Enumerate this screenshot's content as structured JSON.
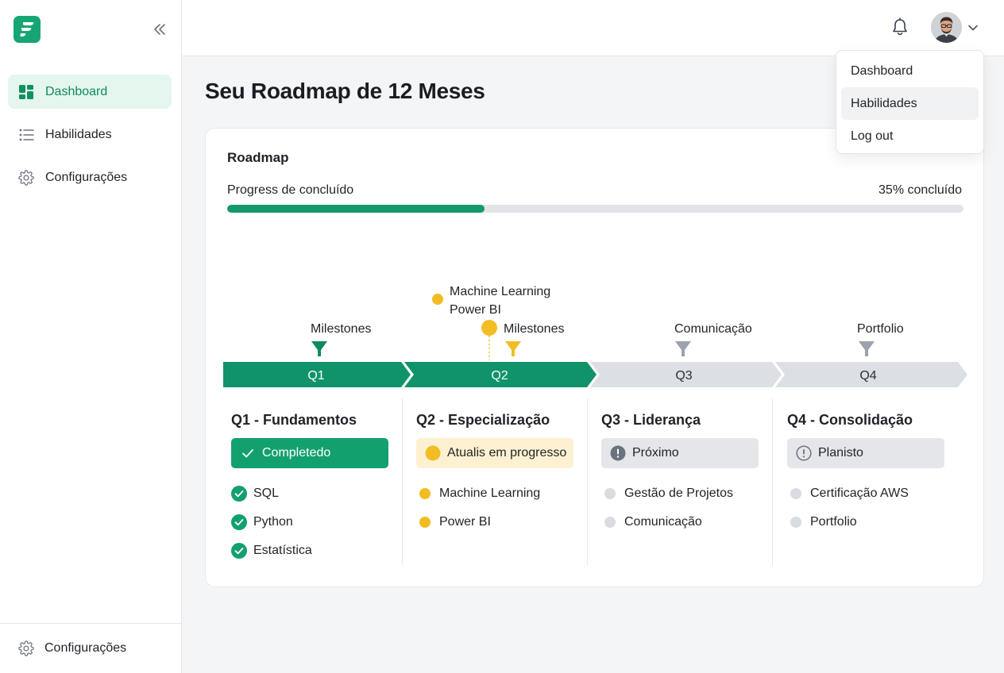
{
  "sidebar": {
    "items": [
      {
        "label": "Dashboard",
        "icon": "dashboard-icon",
        "active": true
      },
      {
        "label": "Habilidades",
        "icon": "list-icon",
        "active": false
      },
      {
        "label": "Configurações",
        "icon": "gear-icon",
        "active": false
      }
    ],
    "bottom_label": "Configurações"
  },
  "user_menu": {
    "items": [
      "Dashboard",
      "Habilidades",
      "Log out"
    ]
  },
  "page": {
    "title": "Seu Roadmap de 12 Meses"
  },
  "roadmap": {
    "title": "Roadmap",
    "progress_label": "Progress de concluído",
    "progress_text": "35% concluído",
    "progress_value": 0.35,
    "quarters": [
      "Q1",
      "Q2",
      "Q3",
      "Q4"
    ],
    "markers": {
      "q1": "Milestones",
      "q2": "Milestones",
      "q2_points": [
        "Machine Learning",
        "Power BI"
      ],
      "q3": "Comunicação",
      "q4": "Portfolio"
    },
    "columns": [
      {
        "title": "Q1 - Fundamentos",
        "status": "Completedo",
        "items": [
          "SQL",
          "Python",
          "Estatística"
        ]
      },
      {
        "title": "Q2 - Especialização",
        "status": "Atualis em progresso",
        "items": [
          "Machine Learning",
          "Power BI"
        ]
      },
      {
        "title": "Q3 - Liderança",
        "status": "Próximo",
        "items": [
          "Gestão de Projetos",
          "Comunicação"
        ]
      },
      {
        "title": "Q4 - Consolidação",
        "status": "Planisto",
        "items": [
          "Certificação AWS",
          "Portfolio"
        ]
      }
    ]
  },
  "colors": {
    "accent": "#13996b",
    "in_progress": "#f2bd23",
    "upcoming": "#d9dce1"
  }
}
